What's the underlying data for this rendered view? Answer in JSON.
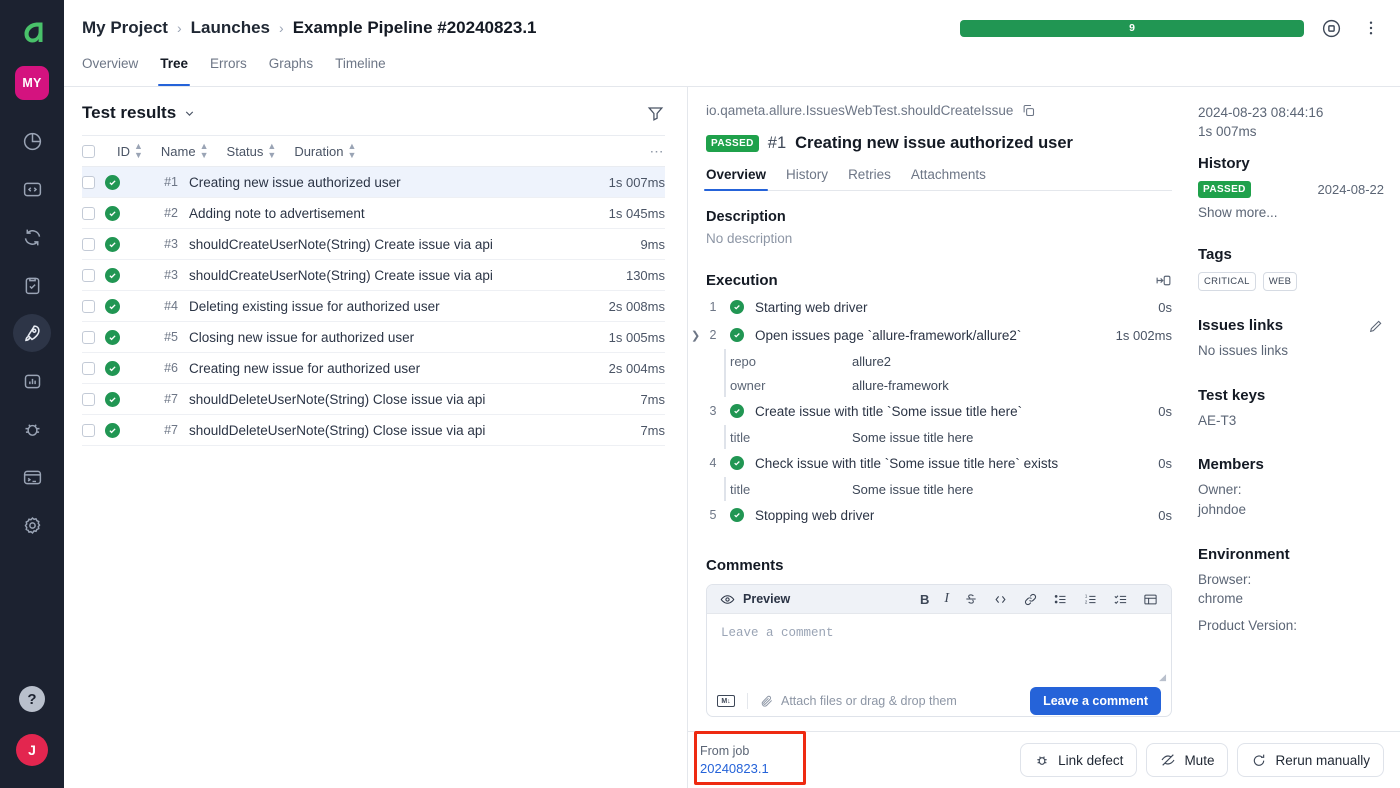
{
  "rail": {
    "logo_name": "allure-logo",
    "avatar_label": "MY",
    "items": [
      {
        "name": "dashboard-icon",
        "label": "Dashboards"
      },
      {
        "name": "code-icon",
        "label": "Code"
      },
      {
        "name": "sync-icon",
        "label": "Sync"
      },
      {
        "name": "clipboard-check-icon",
        "label": "Test plans"
      },
      {
        "name": "rocket-icon",
        "label": "Launches",
        "active": true
      },
      {
        "name": "bar-chart-icon",
        "label": "Analytics"
      },
      {
        "name": "bug-icon",
        "label": "Defects"
      },
      {
        "name": "terminal-icon",
        "label": "Console"
      },
      {
        "name": "gear-icon",
        "label": "Settings"
      }
    ],
    "help_label": "?",
    "user_initial": "J"
  },
  "header": {
    "breadcrumb": [
      {
        "label": "My Project",
        "current": false
      },
      {
        "label": "Launches",
        "current": false
      },
      {
        "label": "Example Pipeline #20240823.1",
        "current": true
      }
    ],
    "separator": "›",
    "progress": {
      "value": "9",
      "percent": 100,
      "color": "#219653"
    },
    "stop_icon": "stop-circle-icon",
    "more_icon": "more-vertical-icon"
  },
  "tabs": [
    {
      "label": "Overview",
      "active": false
    },
    {
      "label": "Tree",
      "active": true
    },
    {
      "label": "Errors",
      "active": false
    },
    {
      "label": "Graphs",
      "active": false
    },
    {
      "label": "Timeline",
      "active": false
    }
  ],
  "left_pane": {
    "title": "Test results",
    "chevron_icon": "chevron-down-icon",
    "filter_icon": "filter-icon",
    "columns": [
      {
        "label": "ID"
      },
      {
        "label": "Name"
      },
      {
        "label": "Status"
      },
      {
        "label": "Duration"
      }
    ],
    "more_icon": "ellipsis-icon",
    "rows": [
      {
        "id": "#1",
        "name": "Creating new issue authorized user",
        "status": "passed",
        "duration": "1s 007ms",
        "selected": true
      },
      {
        "id": "#2",
        "name": "Adding note to advertisement",
        "status": "passed",
        "duration": "1s 045ms",
        "selected": false
      },
      {
        "id": "#3",
        "name": "shouldCreateUserNote(String) Create issue via api",
        "status": "passed",
        "duration": "9ms",
        "selected": false
      },
      {
        "id": "#3",
        "name": "shouldCreateUserNote(String) Create issue via api",
        "status": "passed",
        "duration": "130ms",
        "selected": false
      },
      {
        "id": "#4",
        "name": "Deleting existing issue for authorized user",
        "status": "passed",
        "duration": "2s 008ms",
        "selected": false
      },
      {
        "id": "#5",
        "name": "Closing new issue for authorized user",
        "status": "passed",
        "duration": "1s 005ms",
        "selected": false
      },
      {
        "id": "#6",
        "name": "Creating new issue for authorized user",
        "status": "passed",
        "duration": "2s 004ms",
        "selected": false
      },
      {
        "id": "#7",
        "name": "shouldDeleteUserNote(String) Close issue via api",
        "status": "passed",
        "duration": "7ms",
        "selected": false
      },
      {
        "id": "#7",
        "name": "shouldDeleteUserNote(String) Close issue via api",
        "status": "passed",
        "duration": "7ms",
        "selected": false
      }
    ]
  },
  "detail": {
    "full_name": "io.qameta.allure.IssuesWebTest.shouldCreateIssue",
    "copy_icon": "copy-icon",
    "status_badge": "PASSED",
    "test_number": "#1",
    "test_name": "Creating new issue authorized user",
    "tabs": [
      {
        "label": "Overview",
        "active": true
      },
      {
        "label": "History",
        "active": false
      },
      {
        "label": "Retries",
        "active": false
      },
      {
        "label": "Attachments",
        "active": false
      }
    ],
    "description_title": "Description",
    "description_value": "No description",
    "execution_title": "Execution",
    "execution_icon": "split-view-icon",
    "steps": [
      {
        "num": "1",
        "text": "Starting web driver",
        "duration": "0s",
        "status": "passed",
        "expandable": false,
        "params": []
      },
      {
        "num": "2",
        "text": "Open issues page `allure-framework/allure2`",
        "duration": "1s 002ms",
        "status": "passed",
        "expandable": true,
        "params": [
          {
            "key": "repo",
            "value": "allure2"
          },
          {
            "key": "owner",
            "value": "allure-framework"
          }
        ]
      },
      {
        "num": "3",
        "text": "Create issue with title `Some issue title here`",
        "duration": "0s",
        "status": "passed",
        "expandable": false,
        "params": [
          {
            "key": "title",
            "value": "Some issue title here"
          }
        ]
      },
      {
        "num": "4",
        "text": "Check issue with title `Some issue title here` exists",
        "duration": "0s",
        "status": "passed",
        "expandable": false,
        "params": [
          {
            "key": "title",
            "value": "Some issue title here"
          }
        ]
      },
      {
        "num": "5",
        "text": "Stopping web driver",
        "duration": "0s",
        "status": "passed",
        "expandable": false,
        "params": []
      }
    ],
    "comments_title": "Comments",
    "editor": {
      "preview_label": "Preview",
      "eye_icon": "eye-icon",
      "tools": [
        {
          "name": "bold-icon",
          "glyph": "B"
        },
        {
          "name": "italic-icon",
          "glyph": "I"
        },
        {
          "name": "strikethrough-icon",
          "glyph": "S"
        },
        {
          "name": "code-icon",
          "glyph": "</>"
        },
        {
          "name": "link-icon",
          "glyph": "🔗"
        },
        {
          "name": "bullet-list-icon",
          "glyph": "☰"
        },
        {
          "name": "numbered-list-icon",
          "glyph": "☰"
        },
        {
          "name": "checklist-icon",
          "glyph": "✓"
        },
        {
          "name": "table-icon",
          "glyph": "▦"
        }
      ],
      "placeholder": "Leave a comment",
      "markdown_icon": "markdown-icon",
      "attach_icon": "paperclip-icon",
      "attach_label": "Attach files or drag & drop them",
      "submit_label": "Leave a comment"
    }
  },
  "meta": {
    "timestamp": "2024-08-23 08:44:16",
    "duration": "1s 007ms",
    "history_title": "History",
    "history_status": "PASSED",
    "history_date": "2024-08-22",
    "show_more": "Show more...",
    "tags_title": "Tags",
    "tags": [
      "CRITICAL",
      "WEB"
    ],
    "issues_title": "Issues links",
    "issues_edit_icon": "pencil-icon",
    "issues_value": "No issues links",
    "test_keys_title": "Test keys",
    "test_keys_value": "AE-T3",
    "members_title": "Members",
    "members_label": "Owner:",
    "members_value": "johndoe",
    "environment_title": "Environment",
    "env_browser_label": "Browser:",
    "env_browser_value": "chrome",
    "env_product_label": "Product Version:"
  },
  "actionbar": {
    "from_job_label": "From job",
    "from_job_value": "20240823.1",
    "buttons": [
      {
        "label": "Link defect",
        "icon": "bug-icon"
      },
      {
        "label": "Mute",
        "icon": "eye-off-icon"
      },
      {
        "label": "Rerun manually",
        "icon": "rerun-icon"
      }
    ],
    "highlight_color": "#ee2a11"
  }
}
